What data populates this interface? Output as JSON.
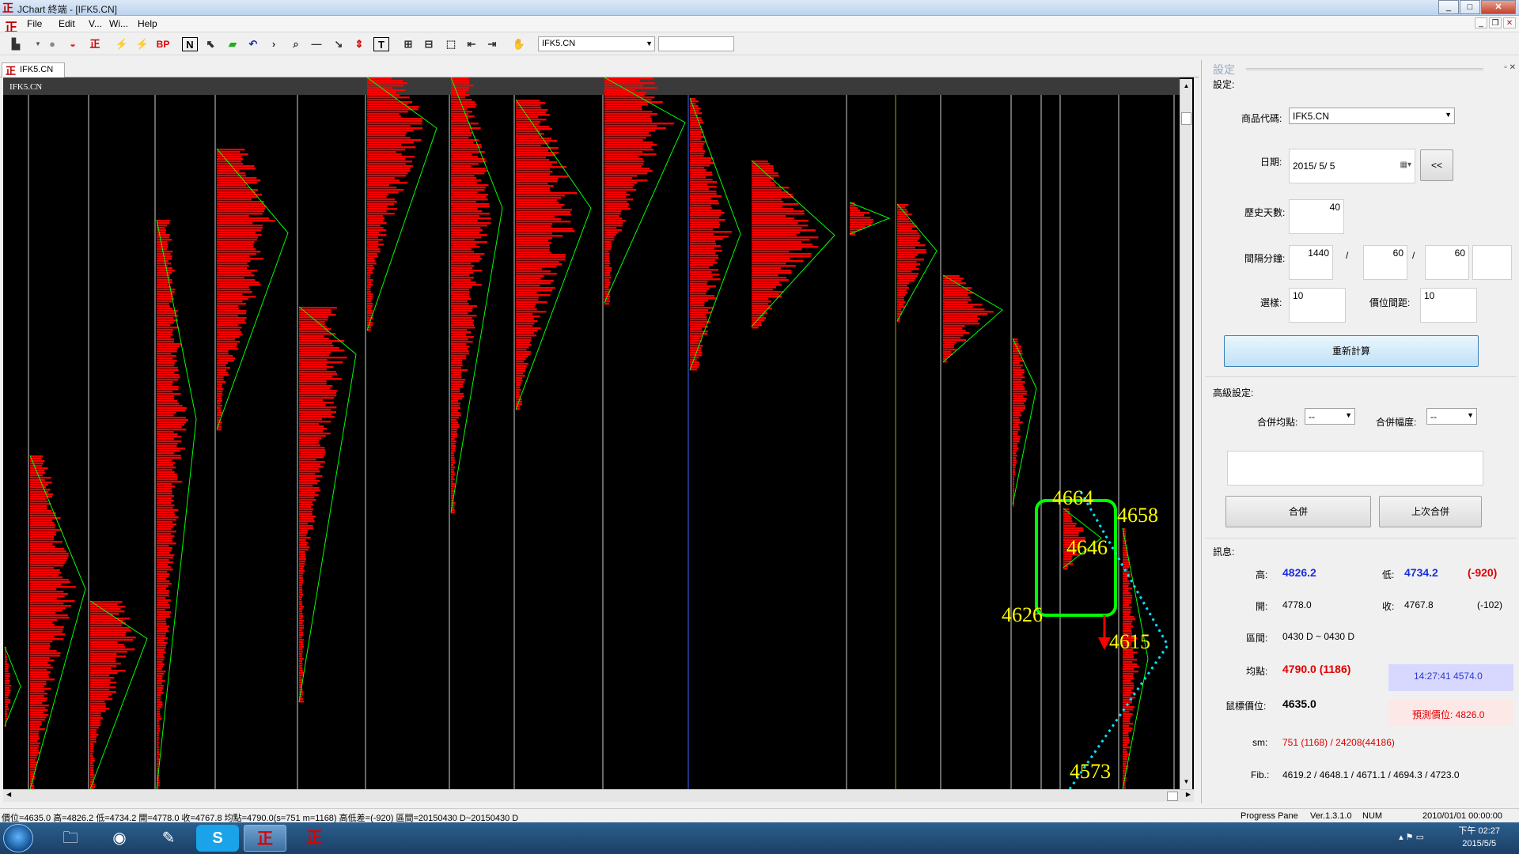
{
  "window": {
    "title": "JChart 終端 - [IFK5.CN]"
  },
  "menu": {
    "items": [
      "File",
      "Edit",
      "V...",
      "Wi...",
      "Help"
    ]
  },
  "toolbar": {
    "symbol_select": "IFK5.CN",
    "text_buttons": [
      "BP",
      "N",
      "T"
    ]
  },
  "doc_tab": {
    "label": "IFK5.CN"
  },
  "chart": {
    "symbol_label": "IFK5.CN",
    "annotations": [
      "4664",
      "4658",
      "4646",
      "4626",
      "4615",
      "4573"
    ],
    "colors": {
      "background": "#000000",
      "profile": "#ff0000",
      "line": "#00ff00",
      "annotation": "#ffff00",
      "box": "#00ff00",
      "dotted": "#00e5ff",
      "arrow": "#ff0000"
    }
  },
  "panel": {
    "caption": "設定",
    "section_settings": "設定:",
    "product_code_label": "商品代碼:",
    "product_code_value": "IFK5.CN",
    "date_label": "日期:",
    "date_value": "2015/ 5/ 5",
    "back_button": "<<",
    "history_days_label": "歷史天數:",
    "history_days_value": "40",
    "interval_label": "間隔分鐘:",
    "interval_values": [
      "1440",
      "60",
      "60"
    ],
    "interval_sep": "/",
    "levels_label": "選樣:",
    "levels_value": "10",
    "price_gap_label": "價位間距:",
    "price_gap_value": "10",
    "recalc_button": "重新計算",
    "advanced_label": "高級設定:",
    "merge_avg_label": "合併均點:",
    "merge_avg_value": "--",
    "merge_range_label": "合併幅度:",
    "merge_range_value": "--",
    "merge_button": "合併",
    "last_merge_button": "上次合併",
    "info_label": "訊息:",
    "high_label": "高:",
    "high_value": "4826.2",
    "low_label": "低:",
    "low_value": "4734.2",
    "low_diff": "(-920)",
    "open_label": "開:",
    "open_value": "4778.0",
    "close_label": "收:",
    "close_value": "4767.8",
    "close_diff": "(-102)",
    "range_label": "區間:",
    "range_value": "0430 D ~ 0430 D",
    "avg_label": "均點:",
    "avg_value": "4790.0 (1186)",
    "avg_time_note": "14:27:41  4574.0",
    "mouse_price_label": "鼠標價位:",
    "mouse_price_value": "4635.0",
    "predict_note": "預測價位: 4826.0",
    "sm_label": "sm:",
    "sm_value": "751 (1168) / 24208(44186)",
    "fib_label": "Fib.:",
    "fib_value": "4619.2 / 4648.1 / 4671.1 / 4694.3 / 4723.0"
  },
  "status": {
    "main": "價位=4635.0  高=4826.2  低=4734.2  開=4778.0  收=4767.8  均點=4790.0(s=751 m=1168)  高低差=(-920)  區間=20150430 D~20150430 D",
    "progress": "Progress Pane",
    "version": "Ver.1.3.1.0",
    "num": "NUM",
    "datetime": "2010/01/01 00:00:00"
  },
  "taskbar": {
    "clock_time": "下午 02:27",
    "clock_date": "2015/5/5"
  }
}
